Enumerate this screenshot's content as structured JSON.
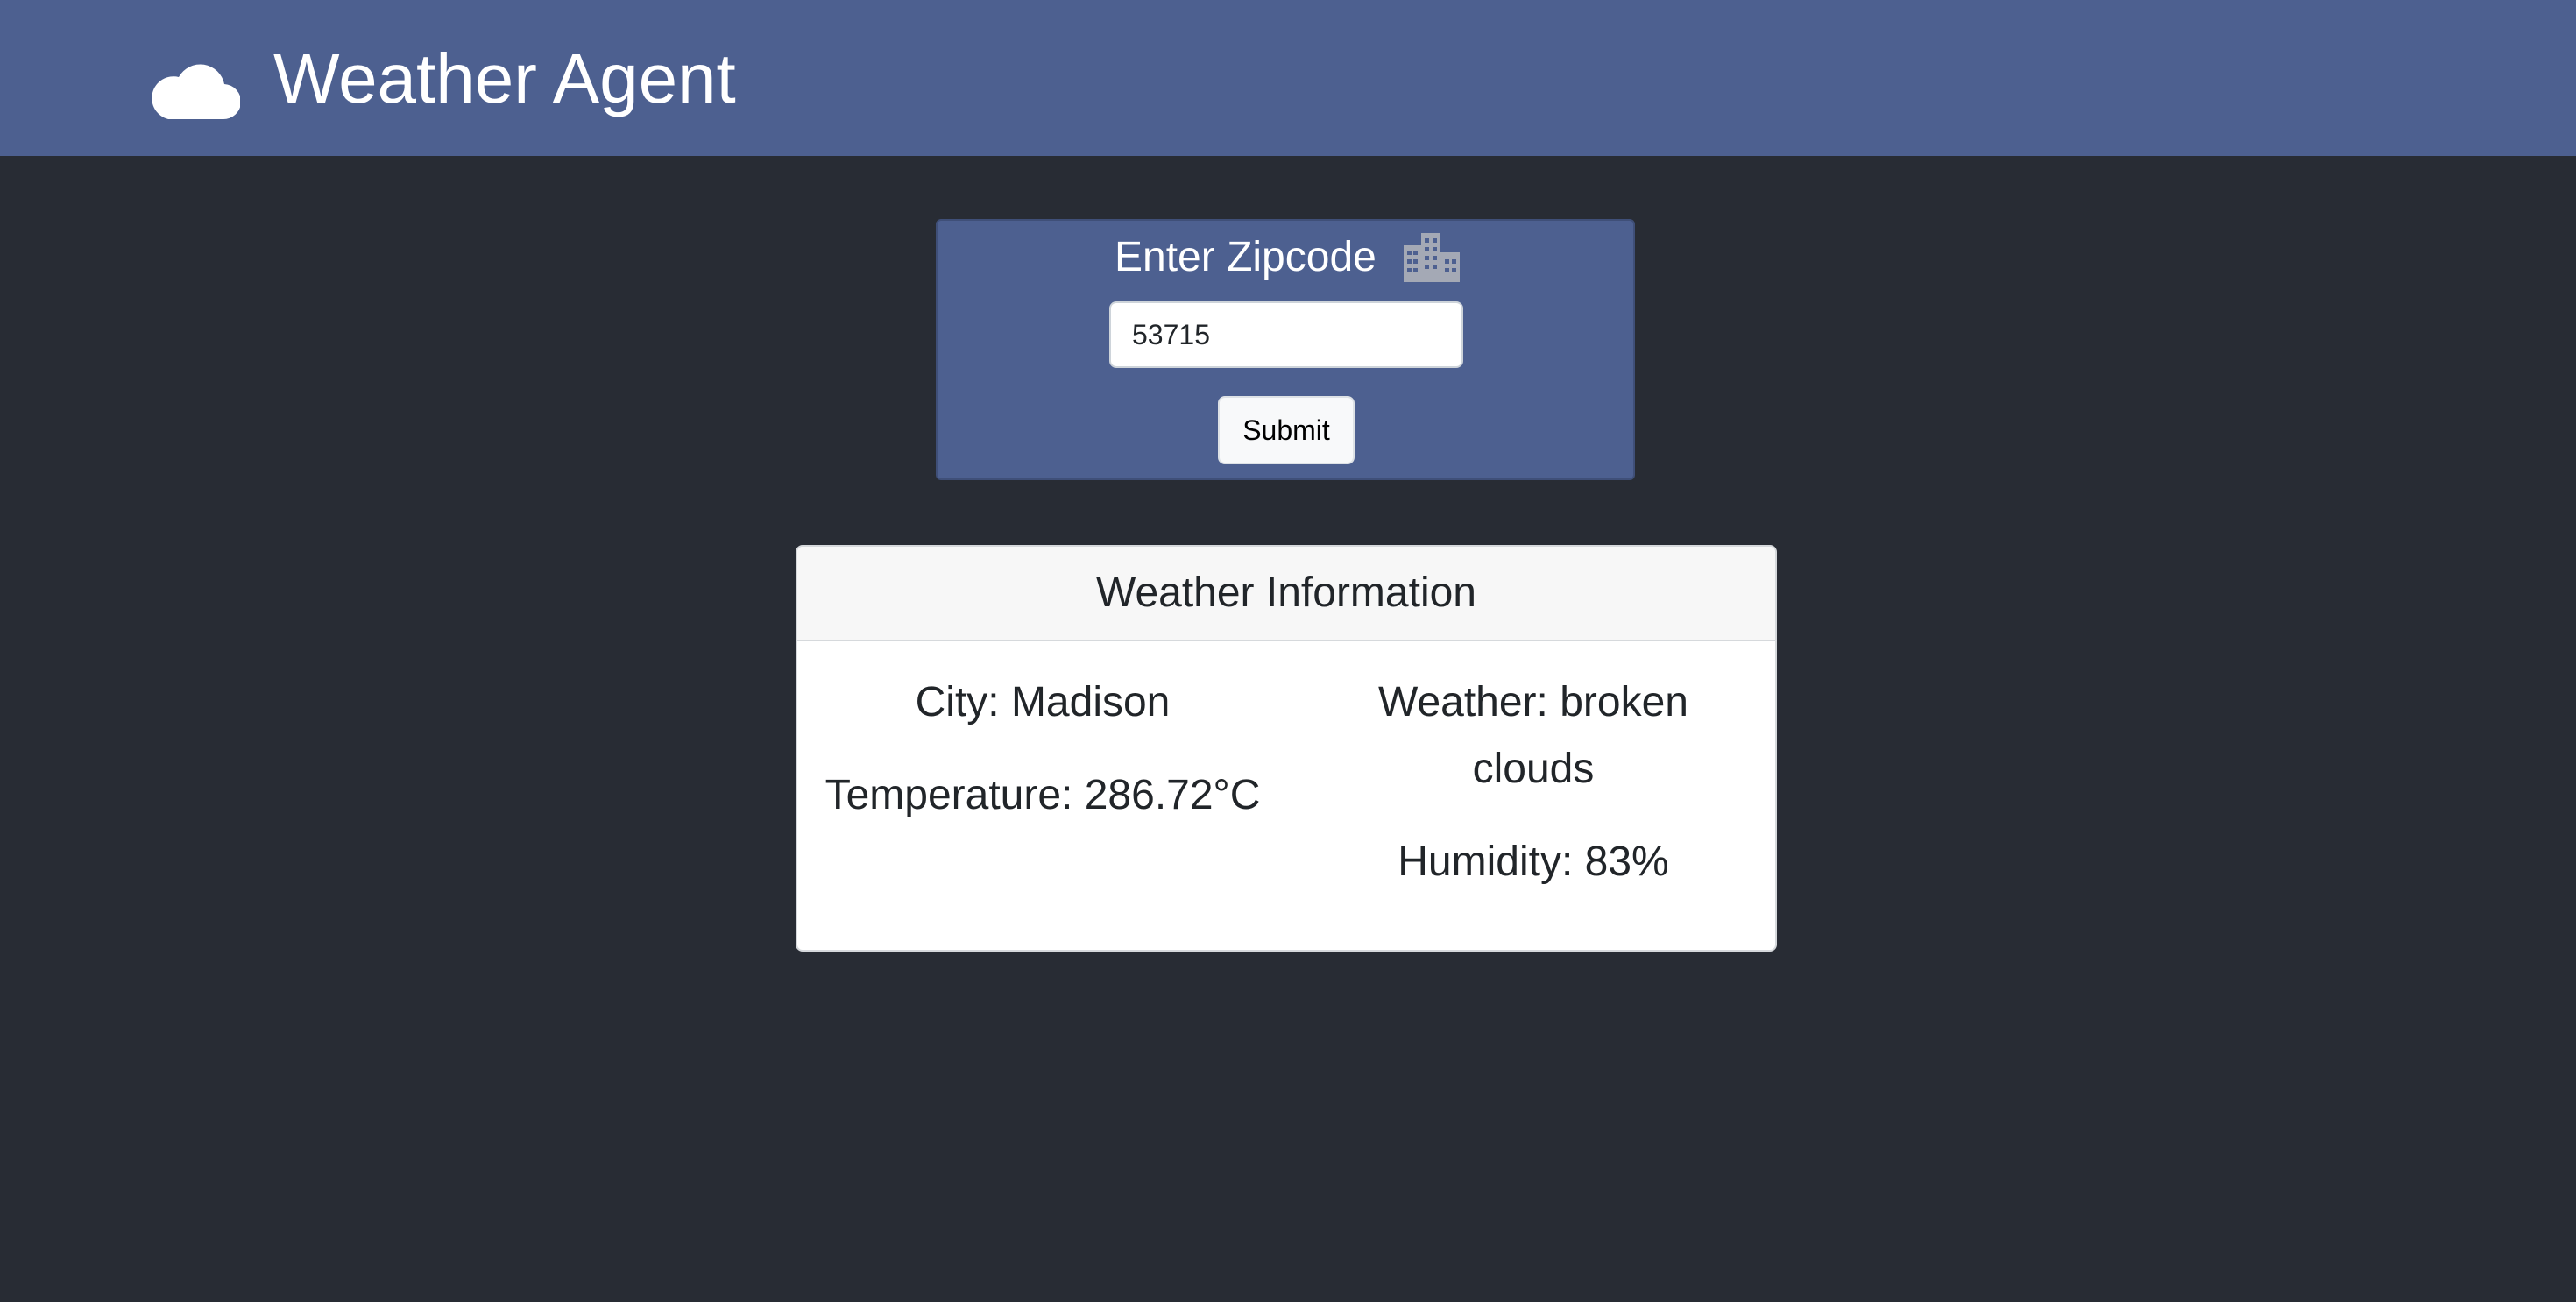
{
  "header": {
    "title": "Weather Agent",
    "logo_icon": "cloud-icon",
    "background": "#4d6090"
  },
  "zip_form": {
    "label": "Enter Zipcode",
    "label_icon": "building-icon",
    "input_value": "53715",
    "submit_label": "Submit"
  },
  "weather_info": {
    "title": "Weather Information",
    "city": "City: Madison",
    "temperature": "Temperature: 286.72°C",
    "weather": "Weather: broken clouds",
    "humidity": "Humidity: 83%"
  },
  "colors": {
    "page_background": "#282c34",
    "accent": "#4d6090",
    "card_background": "#ffffff"
  }
}
